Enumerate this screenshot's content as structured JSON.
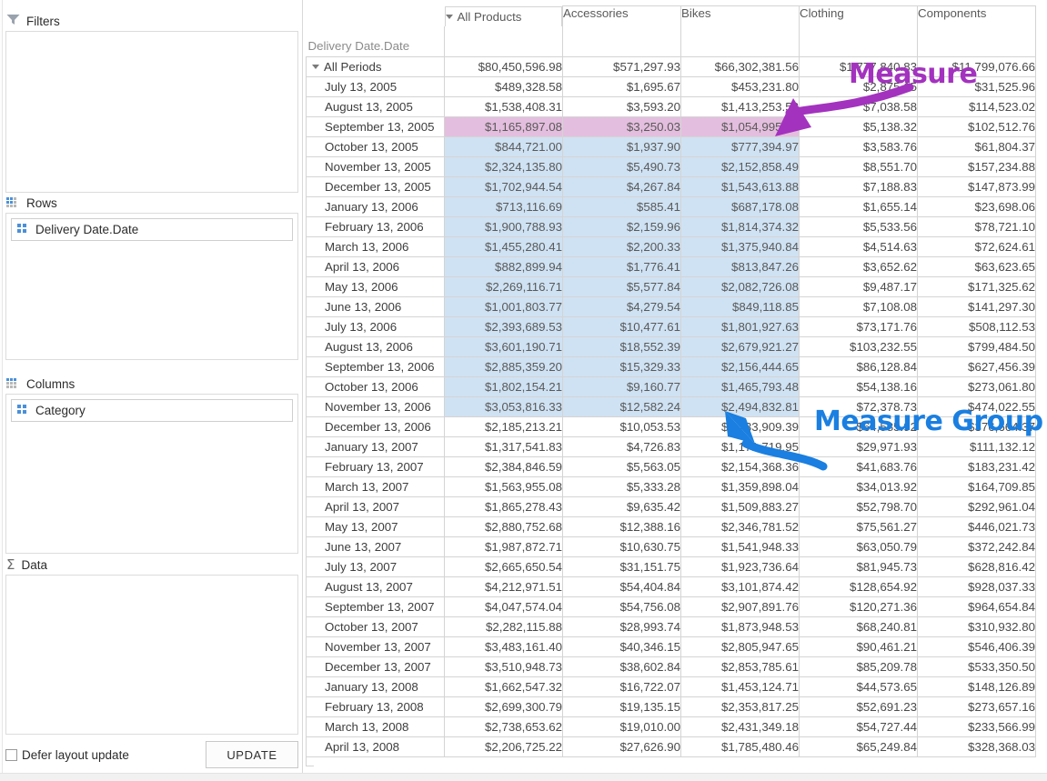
{
  "field_panel": {
    "filters": {
      "label": "Filters",
      "icon": "funnel-icon",
      "items": []
    },
    "rows": {
      "label": "Rows",
      "icon": "grid-icon",
      "items": [
        {
          "label": "Delivery Date.Date",
          "icon": "field-icon"
        }
      ]
    },
    "columns": {
      "label": "Columns",
      "icon": "grid-icon",
      "items": [
        {
          "label": "Category",
          "icon": "field-icon"
        }
      ]
    },
    "data": {
      "label": "Data",
      "icon": "sigma-icon",
      "items": []
    },
    "defer_label": "Defer layout update",
    "defer_checked": false,
    "update_label": "UPDATE"
  },
  "annotations": [
    {
      "name": "measure",
      "text": "Measure",
      "color": "#a332bf"
    },
    {
      "name": "measure-group",
      "text": "Measure Group",
      "color": "#1a7fe0"
    }
  ],
  "pivot": {
    "corner_label": "Delivery Date.Date",
    "column_root": {
      "label": "All Products",
      "expanded": true
    },
    "categories": [
      "Accessories",
      "Bikes",
      "Clothing",
      "Components"
    ],
    "row_root": {
      "label": "All Periods",
      "expanded": true
    },
    "highlight": {
      "pink_row": "September 13, 2005",
      "blue_rows_from": "October 13, 2005",
      "blue_rows_to": "November 13, 2006",
      "blue_columns": 3,
      "pink_columns": 3
    },
    "rows": [
      {
        "label": "All Periods",
        "root": true,
        "values": [
          "$80,450,596.98",
          "$571,297.93",
          "$66,302,381.56",
          "$1,777,840.83",
          "$11,799,076.66"
        ]
      },
      {
        "label": "July 13, 2005",
        "values": [
          "$489,328.58",
          "$1,695.67",
          "$453,231.80",
          "$2,875.15",
          "$31,525.96"
        ]
      },
      {
        "label": "August 13, 2005",
        "values": [
          "$1,538,408.31",
          "$3,593.20",
          "$1,413,253.52",
          "$7,038.58",
          "$114,523.02"
        ]
      },
      {
        "label": "September 13, 2005",
        "values": [
          "$1,165,897.08",
          "$3,250.03",
          "$1,054,995.97",
          "$5,138.32",
          "$102,512.76"
        ]
      },
      {
        "label": "October 13, 2005",
        "values": [
          "$844,721.00",
          "$1,937.90",
          "$777,394.97",
          "$3,583.76",
          "$61,804.37"
        ]
      },
      {
        "label": "November 13, 2005",
        "values": [
          "$2,324,135.80",
          "$5,490.73",
          "$2,152,858.49",
          "$8,551.70",
          "$157,234.88"
        ]
      },
      {
        "label": "December 13, 2005",
        "values": [
          "$1,702,944.54",
          "$4,267.84",
          "$1,543,613.88",
          "$7,188.83",
          "$147,873.99"
        ]
      },
      {
        "label": "January 13, 2006",
        "values": [
          "$713,116.69",
          "$585.41",
          "$687,178.08",
          "$1,655.14",
          "$23,698.06"
        ]
      },
      {
        "label": "February 13, 2006",
        "values": [
          "$1,900,788.93",
          "$2,159.96",
          "$1,814,374.32",
          "$5,533.56",
          "$78,721.10"
        ]
      },
      {
        "label": "March 13, 2006",
        "values": [
          "$1,455,280.41",
          "$2,200.33",
          "$1,375,940.84",
          "$4,514.63",
          "$72,624.61"
        ]
      },
      {
        "label": "April 13, 2006",
        "values": [
          "$882,899.94",
          "$1,776.41",
          "$813,847.26",
          "$3,652.62",
          "$63,623.65"
        ]
      },
      {
        "label": "May 13, 2006",
        "values": [
          "$2,269,116.71",
          "$5,577.84",
          "$2,082,726.08",
          "$9,487.17",
          "$171,325.62"
        ]
      },
      {
        "label": "June 13, 2006",
        "values": [
          "$1,001,803.77",
          "$4,279.54",
          "$849,118.85",
          "$7,108.08",
          "$141,297.30"
        ]
      },
      {
        "label": "July 13, 2006",
        "values": [
          "$2,393,689.53",
          "$10,477.61",
          "$1,801,927.63",
          "$73,171.76",
          "$508,112.53"
        ]
      },
      {
        "label": "August 13, 2006",
        "values": [
          "$3,601,190.71",
          "$18,552.39",
          "$2,679,921.27",
          "$103,232.55",
          "$799,484.50"
        ]
      },
      {
        "label": "September 13, 2006",
        "values": [
          "$2,885,359.20",
          "$15,329.33",
          "$2,156,444.65",
          "$86,128.84",
          "$627,456.39"
        ]
      },
      {
        "label": "October 13, 2006",
        "values": [
          "$1,802,154.21",
          "$9,160.77",
          "$1,465,793.48",
          "$54,138.16",
          "$273,061.80"
        ]
      },
      {
        "label": "November 13, 2006",
        "values": [
          "$3,053,816.33",
          "$12,582.24",
          "$2,494,832.81",
          "$72,378.73",
          "$474,022.55"
        ]
      },
      {
        "label": "December 13, 2006",
        "values": [
          "$2,185,213.21",
          "$10,053.53",
          "$1,733,909.39",
          "$64,585.92",
          "$376,664.37"
        ]
      },
      {
        "label": "January 13, 2007",
        "values": [
          "$1,317,541.83",
          "$4,726.83",
          "$1,171,719.95",
          "$29,971.93",
          "$111,132.12"
        ]
      },
      {
        "label": "February 13, 2007",
        "values": [
          "$2,384,846.59",
          "$5,563.05",
          "$2,154,368.36",
          "$41,683.76",
          "$183,231.42"
        ]
      },
      {
        "label": "March 13, 2007",
        "values": [
          "$1,563,955.08",
          "$5,333.28",
          "$1,359,898.04",
          "$34,013.92",
          "$164,709.85"
        ]
      },
      {
        "label": "April 13, 2007",
        "values": [
          "$1,865,278.43",
          "$9,635.42",
          "$1,509,883.27",
          "$52,798.70",
          "$292,961.04"
        ]
      },
      {
        "label": "May 13, 2007",
        "values": [
          "$2,880,752.68",
          "$12,388.16",
          "$2,346,781.52",
          "$75,561.27",
          "$446,021.73"
        ]
      },
      {
        "label": "June 13, 2007",
        "values": [
          "$1,987,872.71",
          "$10,630.75",
          "$1,541,948.33",
          "$63,050.79",
          "$372,242.84"
        ]
      },
      {
        "label": "July 13, 2007",
        "values": [
          "$2,665,650.54",
          "$31,151.75",
          "$1,923,736.64",
          "$81,945.73",
          "$628,816.42"
        ]
      },
      {
        "label": "August 13, 2007",
        "values": [
          "$4,212,971.51",
          "$54,404.84",
          "$3,101,874.42",
          "$128,654.92",
          "$928,037.33"
        ]
      },
      {
        "label": "September 13, 2007",
        "values": [
          "$4,047,574.04",
          "$54,756.08",
          "$2,907,891.76",
          "$120,271.36",
          "$964,654.84"
        ]
      },
      {
        "label": "October 13, 2007",
        "values": [
          "$2,282,115.88",
          "$28,993.74",
          "$1,873,948.53",
          "$68,240.81",
          "$310,932.80"
        ]
      },
      {
        "label": "November 13, 2007",
        "values": [
          "$3,483,161.40",
          "$40,346.15",
          "$2,805,947.65",
          "$90,461.21",
          "$546,406.39"
        ]
      },
      {
        "label": "December 13, 2007",
        "values": [
          "$3,510,948.73",
          "$38,602.84",
          "$2,853,785.61",
          "$85,209.78",
          "$533,350.50"
        ]
      },
      {
        "label": "January 13, 2008",
        "values": [
          "$1,662,547.32",
          "$16,722.07",
          "$1,453,124.71",
          "$44,573.65",
          "$148,126.89"
        ]
      },
      {
        "label": "February 13, 2008",
        "values": [
          "$2,699,300.79",
          "$19,135.15",
          "$2,353,817.25",
          "$52,691.23",
          "$273,657.16"
        ]
      },
      {
        "label": "March 13, 2008",
        "values": [
          "$2,738,653.62",
          "$19,010.00",
          "$2,431,349.18",
          "$54,727.44",
          "$233,566.99"
        ]
      },
      {
        "label": "April 13, 2008",
        "values": [
          "$2,206,725.22",
          "$27,626.90",
          "$1,785,480.46",
          "$65,249.84",
          "$328,368.03"
        ]
      }
    ]
  },
  "colors": {
    "pink_highlight": "#e4bede",
    "blue_highlight": "#cfe2f3",
    "measure_anno": "#a332bf",
    "measure_group_anno": "#1a7fe0",
    "field_icon": "#4a90d9"
  }
}
